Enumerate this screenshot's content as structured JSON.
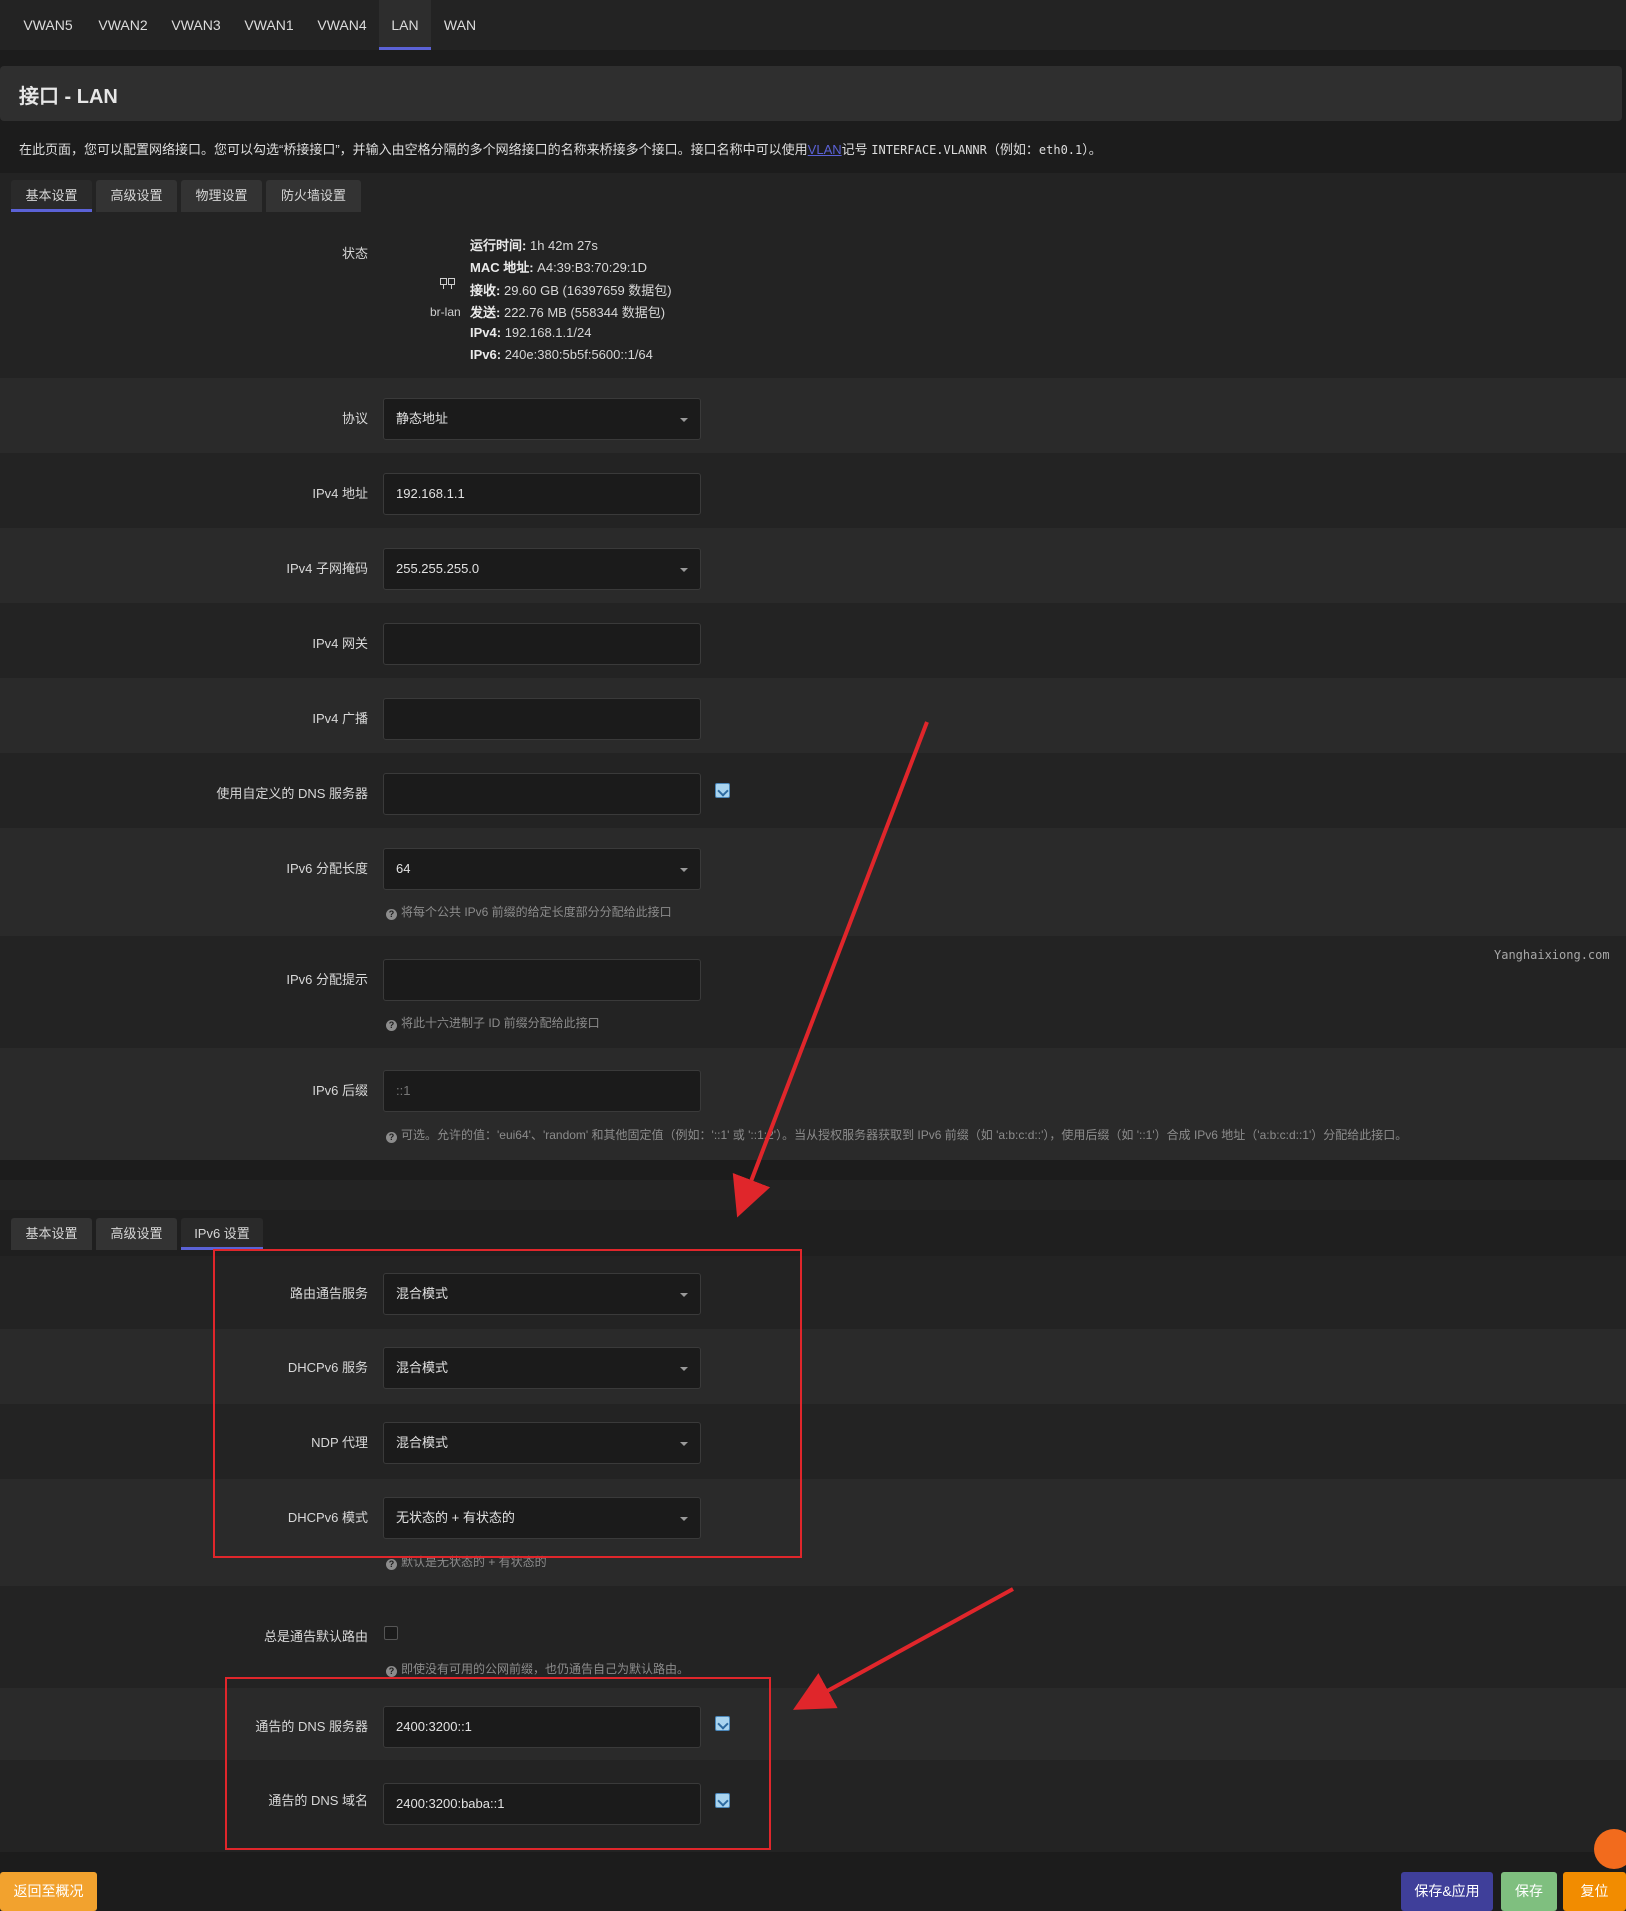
{
  "iface_tabs": [
    "VWAN5",
    "VWAN2",
    "VWAN3",
    "VWAN1",
    "VWAN4",
    "LAN",
    "WAN"
  ],
  "page_title": "接口 - LAN",
  "description": {
    "part1": "在此页面，您可以配置网络接口。您可以勾选“桥接接口”，并输入由空格分隔的多个网络接口的名称来桥接多个接口。接口名称中可以使用",
    "vlan_link": "VLAN",
    "part2": "记号",
    "code1": "INTERFACE.VLANNR",
    "part3": "（例如：",
    "code2": "eth0.1",
    "part4": "）。"
  },
  "section1_tabs": [
    "基本设置",
    "高级设置",
    "物理设置",
    "防火墙设置"
  ],
  "status": {
    "label": "状态",
    "device": "br-lan",
    "lines": [
      {
        "key": "运行时间:",
        "value": "1h 42m 27s"
      },
      {
        "key": "MAC 地址:",
        "value": "A4:39:B3:70:29:1D"
      },
      {
        "key": "接收:",
        "value": "29.60 GB (16397659 数据包)"
      },
      {
        "key": "发送:",
        "value": "222.76 MB (558344 数据包)"
      },
      {
        "key": "IPv4:",
        "value": "192.168.1.1/24"
      },
      {
        "key": "IPv6:",
        "value": "240e:380:5b5f:5600::1/64"
      }
    ]
  },
  "fields": {
    "protocol": {
      "label": "协议",
      "value": "静态地址"
    },
    "ipv4_addr": {
      "label": "IPv4 地址",
      "value": "192.168.1.1"
    },
    "ipv4_mask": {
      "label": "IPv4 子网掩码",
      "value": "255.255.255.0"
    },
    "ipv4_gw": {
      "label": "IPv4 网关",
      "value": ""
    },
    "ipv4_bcast": {
      "label": "IPv4 广播",
      "value": ""
    },
    "custom_dns": {
      "label": "使用自定义的 DNS 服务器",
      "value": ""
    },
    "ipv6_assign_len": {
      "label": "IPv6 分配长度",
      "value": "64",
      "hint": "将每个公共 IPv6 前缀的给定长度部分分配给此接口"
    },
    "ipv6_assign_hint": {
      "label": "IPv6 分配提示",
      "value": "",
      "hint": "将此十六进制子 ID 前缀分配给此接口"
    },
    "ipv6_suffix": {
      "label": "IPv6 后缀",
      "placeholder": "::1",
      "hint": "可选。允许的值：'eui64'、'random' 和其他固定值（例如：'::1' 或 '::1:2'）。当从授权服务器获取到 IPv6 前缀（如 'a:b:c:d::'），使用后缀（如 '::1'）合成 IPv6 地址（'a:b:c:d::1'）分配给此接口。"
    }
  },
  "section2_tabs": [
    "基本设置",
    "高级设置",
    "IPv6 设置"
  ],
  "ipv6": {
    "ra": {
      "label": "路由通告服务",
      "value": "混合模式"
    },
    "dhcpv6": {
      "label": "DHCPv6 服务",
      "value": "混合模式"
    },
    "ndp": {
      "label": "NDP 代理",
      "value": "混合模式"
    },
    "dhcpv6_mode": {
      "label": "DHCPv6 模式",
      "value": "无状态的 + 有状态的",
      "hint": "默认是无状态的 + 有状态的"
    },
    "default_route": {
      "label": "总是通告默认路由",
      "hint": "即使没有可用的公网前缀，也仍通告自己为默认路由。"
    },
    "dns_server": {
      "label": "通告的 DNS 服务器",
      "value": "2400:3200::1"
    },
    "dns_domain": {
      "label": "通告的 DNS 域名",
      "value": "2400:3200:baba::1"
    }
  },
  "watermark": "Yanghaixiong.com",
  "buttons": {
    "back": "返回至概况",
    "save_apply": "保存&应用",
    "save": "保存",
    "reset": "复位"
  },
  "colors": {
    "accent": "#5b62d6",
    "annotation": "#e0262b",
    "back_btn": "#f2a22e",
    "save_apply_btn": "#3f3f9a",
    "save_btn": "#7fbf7f",
    "reset_btn": "#f28c00"
  }
}
